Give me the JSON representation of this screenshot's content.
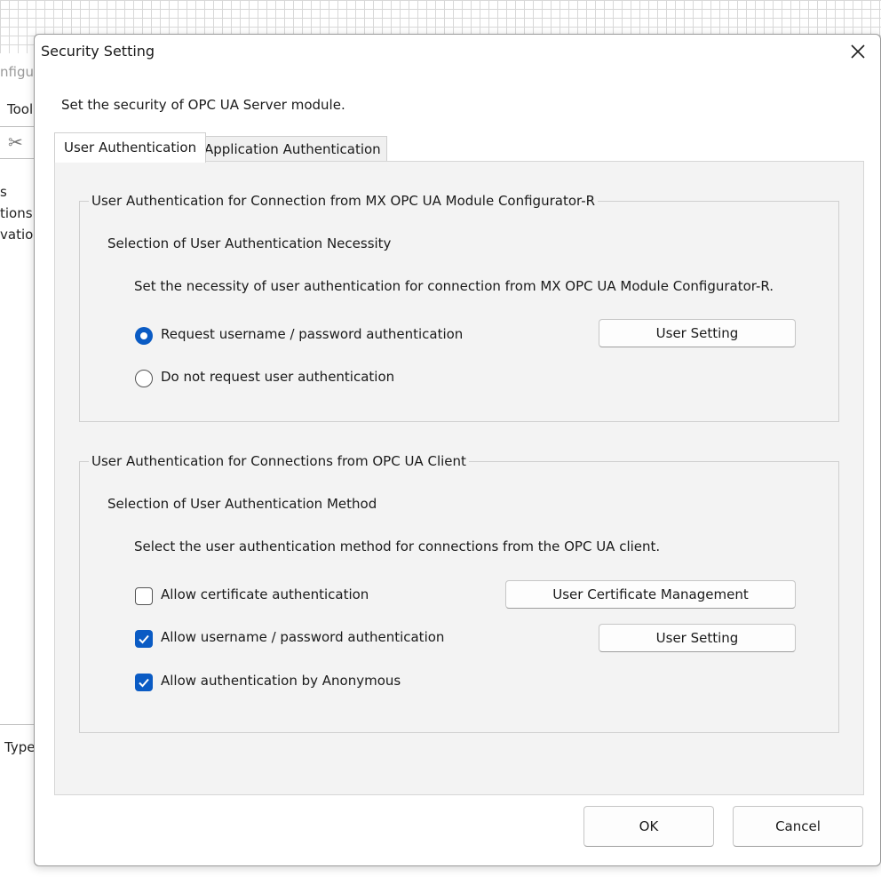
{
  "background": {
    "title_fragment": "nfigu",
    "menu_fragment": "Tool",
    "side_fragments": [
      "s",
      "tions",
      "vation"
    ],
    "bottom_fragment": "Type",
    "cut_icon": "scissors-icon"
  },
  "dialog": {
    "title": "Security Setting",
    "close_icon": "close-icon",
    "description": "Set the security of OPC UA Server module.",
    "tabs": [
      {
        "label": "User Authentication",
        "active": true
      },
      {
        "label": "Application Authentication",
        "active": false
      }
    ],
    "group1": {
      "legend": "User Authentication for Connection from MX OPC UA Module Configurator-R",
      "subheading": "Selection of User Authentication Necessity",
      "instruction": "Set the necessity of user authentication for connection from MX OPC UA Module Configurator-R.",
      "options": [
        {
          "label": "Request username / password authentication",
          "selected": true
        },
        {
          "label": "Do not request user authentication",
          "selected": false
        }
      ],
      "user_setting_button": "User Setting"
    },
    "group2": {
      "legend": "User Authentication for Connections from OPC UA Client",
      "subheading": "Selection of User Authentication Method",
      "instruction": "Select the user authentication method for connections from the OPC UA client.",
      "options": [
        {
          "label": "Allow certificate authentication",
          "checked": false
        },
        {
          "label": "Allow username / password authentication",
          "checked": true
        },
        {
          "label": "Allow authentication by Anonymous",
          "checked": true
        }
      ],
      "cert_button": "User Certificate Management",
      "user_setting_button": "User Setting"
    },
    "ok_button": "OK",
    "cancel_button": "Cancel"
  },
  "colors": {
    "accent": "#0a5bc4"
  }
}
